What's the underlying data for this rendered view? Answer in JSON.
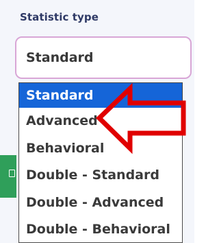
{
  "field": {
    "label": "Statistic type",
    "selected_value": "Standard"
  },
  "dropdown": {
    "options": [
      {
        "label": "Standard"
      },
      {
        "label": "Advanced"
      },
      {
        "label": "Behavioral"
      },
      {
        "label": "Double - Standard"
      },
      {
        "label": "Double - Advanced"
      },
      {
        "label": "Double - Behavioral"
      }
    ],
    "selected_index": 0
  },
  "colors": {
    "label_text": "#2f3a66",
    "select_border": "#d8a6d6",
    "selected_option_bg": "#1565d8",
    "annotation_arrow": "#e00000",
    "side_chip": "#2f9f5a"
  },
  "icons": {
    "annotation": "red-arrow-icon",
    "side_chip_glyph": "clipboard-icon"
  }
}
